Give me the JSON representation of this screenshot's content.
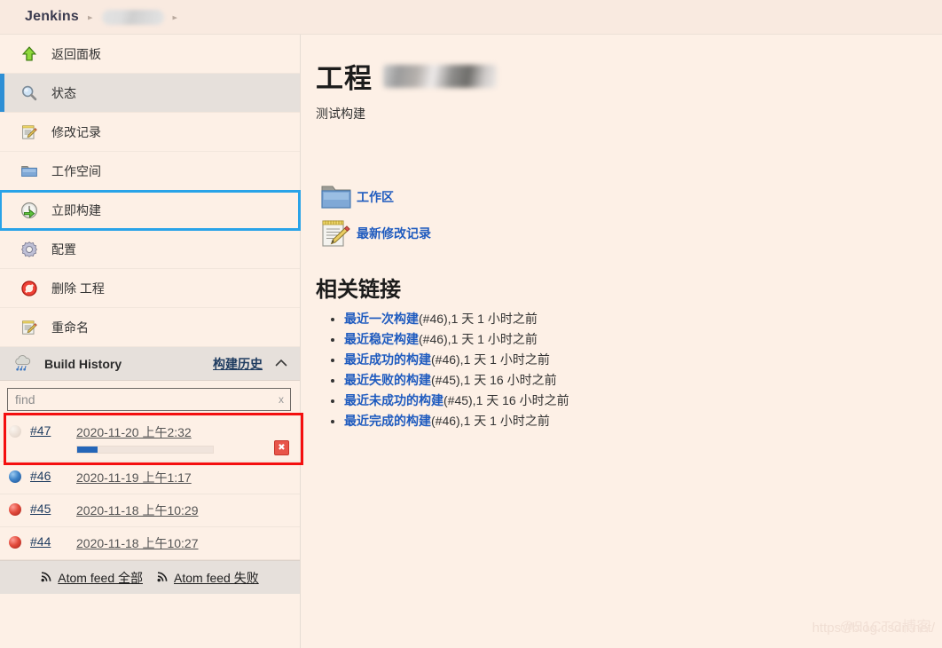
{
  "header": {
    "brand": "Jenkins",
    "separator": "▸",
    "project_crumb_redacted": true
  },
  "sidebar": {
    "items": [
      {
        "label": "返回面板",
        "icon": "up-arrow-icon",
        "state": "normal"
      },
      {
        "label": "状态",
        "icon": "magnifier-icon",
        "state": "active"
      },
      {
        "label": "修改记录",
        "icon": "notepad-pencil-icon",
        "state": "normal"
      },
      {
        "label": "工作空间",
        "icon": "folder-icon",
        "state": "normal"
      },
      {
        "label": "立即构建",
        "icon": "build-clock-icon",
        "state": "highlighted"
      },
      {
        "label": "配置",
        "icon": "gear-icon",
        "state": "normal"
      },
      {
        "label": "删除 工程",
        "icon": "delete-forbidden-icon",
        "state": "normal"
      },
      {
        "label": "重命名",
        "icon": "notepad-pencil-icon",
        "state": "normal"
      }
    ]
  },
  "build_history": {
    "icon": "weather-cloud-icon",
    "title": "Build History",
    "link_label": "构建历史",
    "collapse_icon": "chevron-up-icon",
    "find": {
      "placeholder": "find",
      "value": "",
      "clear_label": "x"
    },
    "builds": [
      {
        "number": "#47",
        "date": "2020-11-20 上午2:32",
        "status": "in-progress",
        "ball": "grey",
        "progress_percent": 15,
        "has_stop_button": true,
        "highlighted": true
      },
      {
        "number": "#46",
        "date": "2020-11-19 上午1:17",
        "status": "success",
        "ball": "blue",
        "progress_percent": null,
        "has_stop_button": false,
        "highlighted": false
      },
      {
        "number": "#45",
        "date": "2020-11-18 上午10:29",
        "status": "failed",
        "ball": "red",
        "progress_percent": null,
        "has_stop_button": false,
        "highlighted": false
      },
      {
        "number": "#44",
        "date": "2020-11-18 上午10:27",
        "status": "failed",
        "ball": "red",
        "progress_percent": null,
        "has_stop_button": false,
        "highlighted": false
      }
    ],
    "feeds": [
      {
        "icon": "rss-icon",
        "label": "Atom feed 全部"
      },
      {
        "icon": "rss-icon",
        "label": "Atom feed 失败"
      }
    ]
  },
  "main": {
    "page_title": "工程",
    "page_title_redacted": true,
    "subtitle": "测试构建",
    "quick_links": [
      {
        "icon": "folder-icon",
        "label": "工作区"
      },
      {
        "icon": "notepad-pencil-icon",
        "label": "最新修改记录"
      }
    ],
    "related_links_title": "相关链接",
    "related_links": [
      {
        "label": "最近一次构建",
        "meta": "(#46),1 天 1 小时之前"
      },
      {
        "label": "最近稳定构建",
        "meta": "(#46),1 天 1 小时之前"
      },
      {
        "label": "最近成功的构建",
        "meta": "(#46),1 天 1 小时之前"
      },
      {
        "label": "最近失败的构建",
        "meta": "(#45),1 天 16 小时之前"
      },
      {
        "label": "最近未成功的构建",
        "meta": "(#45),1 天 16 小时之前"
      },
      {
        "label": "最近完成的构建",
        "meta": "(#46),1 天 1 小时之前"
      }
    ]
  },
  "watermarks": {
    "primary": "https://blog.csdn.net/",
    "secondary": "@51CTO博客"
  },
  "colors": {
    "page_bg": "#fdf0e6",
    "header_bg": "#f9eae0",
    "active_item_bg": "#e6e0db",
    "active_accent": "#2d8fd5",
    "highlight_box": "#29a3e8",
    "build_highlight_box": "#f40f0f",
    "link": "#1f5bbf",
    "progress_fill": "#2566b8"
  }
}
